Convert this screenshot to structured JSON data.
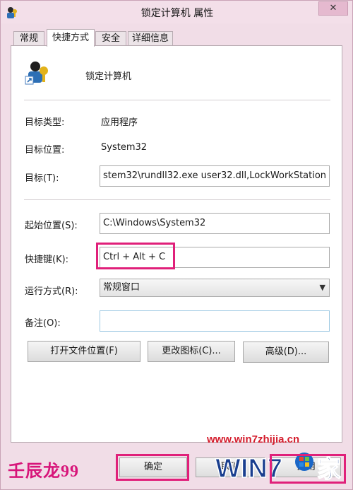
{
  "window": {
    "title": "锁定计算机  属性",
    "close_glyph": "✕"
  },
  "tabs": [
    {
      "label": "常规"
    },
    {
      "label": "快捷方式"
    },
    {
      "label": "安全"
    },
    {
      "label": "详细信息"
    }
  ],
  "shortcut": {
    "name": "锁定计算机",
    "target_type_label": "目标类型:",
    "target_type_value": "应用程序",
    "target_location_label": "目标位置:",
    "target_location_value": "System32",
    "target_label": "目标(T):",
    "target_value": "stem32\\rundll32.exe user32.dll,LockWorkStation",
    "start_in_label": "起始位置(S):",
    "start_in_value": "C:\\Windows\\System32",
    "hotkey_label": "快捷键(K):",
    "hotkey_value": "Ctrl + Alt + C",
    "run_label": "运行方式(R):",
    "run_value": "常规窗口",
    "comment_label": "备注(O):",
    "comment_value": ""
  },
  "buttons": {
    "open_location": "打开文件位置(F)",
    "change_icon": "更改图标(C)...",
    "advanced": "高级(D)...",
    "ok": "确定",
    "cancel": "取消",
    "apply": "应用"
  },
  "watermark": {
    "url": "www.win7zhijia.cn",
    "author": "壬辰龙99",
    "logo_text": "WIN7",
    "logo_suffix": "家"
  },
  "colors": {
    "highlight": "#e0207a",
    "watermark_red": "#d41c2c"
  }
}
